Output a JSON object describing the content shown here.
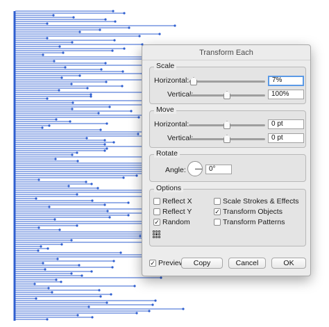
{
  "dialog": {
    "title": "Transform Each",
    "scale": {
      "legend": "Scale",
      "horizontal_label": "Horizontal:",
      "horizontal_value": "7%",
      "horizontal_slider_level": 0.02,
      "vertical_label": "Vertical:",
      "vertical_value": "100%",
      "vertical_slider_level": 0.5
    },
    "move": {
      "legend": "Move",
      "horizontal_label": "Horizontal:",
      "horizontal_value": "0 pt",
      "horizontal_slider_level": 0.5,
      "vertical_label": "Vertical:",
      "vertical_value": "0 pt",
      "vertical_slider_level": 0.5
    },
    "rotate": {
      "legend": "Rotate",
      "angle_label": "Angle:",
      "angle_value": "0°"
    },
    "options": {
      "legend": "Options",
      "reflect_x": {
        "label": "Reflect X",
        "checked": false
      },
      "reflect_y": {
        "label": "Reflect Y",
        "checked": false
      },
      "random": {
        "label": "Random",
        "checked": true
      },
      "scale_strokes": {
        "label": "Scale Strokes & Effects",
        "checked": false
      },
      "transform_objects": {
        "label": "Transform Objects",
        "checked": true
      },
      "transform_patterns": {
        "label": "Transform Patterns",
        "checked": false
      }
    },
    "preview": {
      "label": "Preview",
      "checked": true
    },
    "copy_label": "Copy",
    "cancel_label": "Cancel",
    "ok_label": "OK"
  },
  "colors": {
    "artwork_line": "#2f5fd0",
    "focus_ring": "#5b9ae6"
  },
  "icons": {
    "reference_point": "reference-point-grid-icon",
    "angle_dial": "angle-dial-icon"
  }
}
